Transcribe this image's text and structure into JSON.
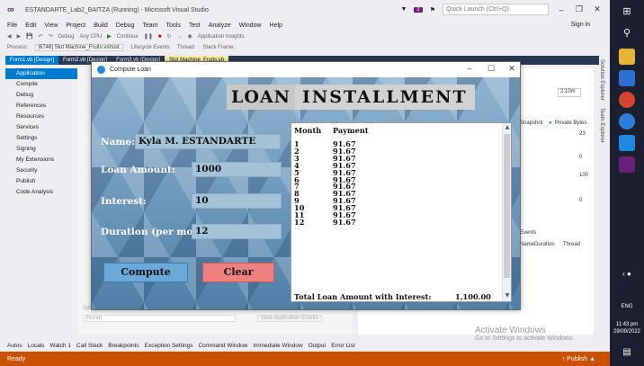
{
  "vs": {
    "title": "ESTANDARTE_Lab2_BAITZA (Running) - Microsoft Visual Studio",
    "quick_launch": "Quick Launch (Ctrl+Q)",
    "notif_count": "2",
    "sign_in": "Sign in",
    "menu": [
      "File",
      "Edit",
      "View",
      "Project",
      "Build",
      "Debug",
      "Team",
      "Tools",
      "Test",
      "Analyze",
      "Window",
      "Help"
    ],
    "toolbar": {
      "config": "Debug",
      "platform": "Any CPU",
      "continue": "Continue",
      "insights": "Application Insights"
    },
    "process_label": "Process:",
    "process_value": "[6748] Slot Machine_Fruits.vshost.",
    "lifecycle": "Lifecycle Events",
    "thread": "Thread:",
    "stack_frame": "Stack Frame:",
    "doc_tabs": [
      "Form1.vb [Design]",
      "Form2.vb [Design]",
      "Form3.vb [Design]",
      "Slot Machine_Fruits.vb"
    ],
    "nav_items": [
      "Application",
      "Compile",
      "Debug",
      "References",
      "Resources",
      "Services",
      "Settings",
      "Signing",
      "My Extensions",
      "Security",
      "Publish",
      "Code Analysis"
    ],
    "splash_label": "Splash screen:",
    "splash_value": "(None)",
    "view_events": "View Application Events",
    "diag": {
      "time": "2:10m",
      "snapshot": "Snapshot",
      "private_bytes": "Private Bytes",
      "v1": "23",
      "v2": "0",
      "v3": "100",
      "v4": "0",
      "events": "Events",
      "col_name": "Name",
      "col_duration": "Duration",
      "col_thread": "Thread"
    },
    "side_tabs": [
      "Solution Explorer",
      "Team Explorer"
    ],
    "bottom_tabs": [
      "Autos",
      "Locals",
      "Watch 1",
      "Call Stack",
      "Breakpoints",
      "Exception Settings",
      "Command Window",
      "Immediate Window",
      "Output",
      "Error List"
    ],
    "status": "Ready",
    "publish": "Publish",
    "activate_title": "Activate Windows",
    "activate_sub": "Go to Settings to activate Windows."
  },
  "taskbar": {
    "lang": "ENG",
    "time": "11:43 pm",
    "date": "29/09/2022"
  },
  "loan": {
    "window_title": "Compute Loan",
    "banner_word1": "LOAN",
    "banner_word2": "INSTALLMENT",
    "name_label": "Name:",
    "name_value": "Kyla M. ESTANDARTE",
    "amount_label": "Loan Amount:",
    "amount_value": "1000",
    "interest_label": "Interest:",
    "interest_value": "10",
    "duration_label": "Duration (per month):",
    "duration_value": "12",
    "compute_label": "Compute",
    "clear_label": "Clear",
    "schedule": {
      "month_header": "Month",
      "payment_header": "Payment",
      "rows": [
        {
          "m": "1",
          "p": "91.67"
        },
        {
          "m": "2",
          "p": "91.67"
        },
        {
          "m": "3",
          "p": "91.67"
        },
        {
          "m": "4",
          "p": "91.67"
        },
        {
          "m": "5",
          "p": "91.67"
        },
        {
          "m": "6",
          "p": "91.67"
        },
        {
          "m": "7",
          "p": "91.67"
        },
        {
          "m": "8",
          "p": "91.67"
        },
        {
          "m": "9",
          "p": "91.67"
        },
        {
          "m": "10",
          "p": "91.67"
        },
        {
          "m": "11",
          "p": "91.67"
        },
        {
          "m": "12",
          "p": "91.67"
        }
      ],
      "total_label": "Total Loan Amount with Interest:",
      "total_value": "1,100.00"
    }
  }
}
